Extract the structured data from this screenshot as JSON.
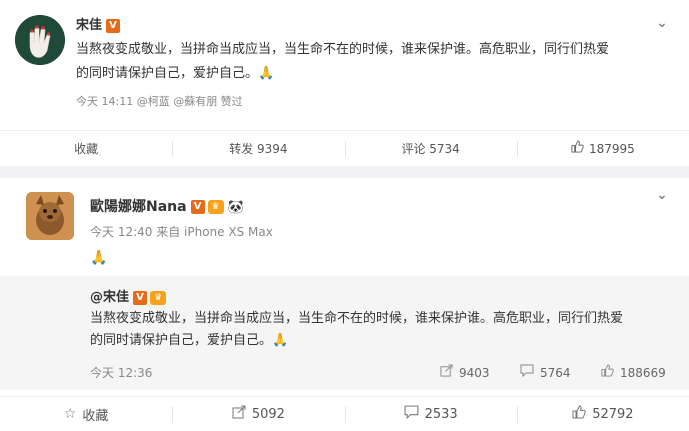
{
  "post1": {
    "author": "宋佳",
    "verified_badge": "V",
    "text_line1": "当熬夜变成敬业，当拼命当成应当，当生命不在的时候，谁来保护谁。高危职业，同行们热爱",
    "text_line2": "的同时请保护自己，爱护自己。🙏",
    "meta": "今天 14:11 @柯蓝 @蘇有朋 赞过",
    "actions": {
      "favorite": "收藏",
      "repost": "转发 9394",
      "comment": "评论 5734",
      "like": "187995"
    }
  },
  "post2": {
    "author": "歐陽娜娜Nana",
    "verified_badge": "V",
    "crown_badge": "♛",
    "panda": "🐼",
    "meta": "今天 12:40 来自 iPhone XS Max",
    "text": "🙏",
    "repost": {
      "author": "@宋佳",
      "verified_badge": "V",
      "crown_badge": "♛",
      "text_line1": "当熬夜变成敬业，当拼命当成应当，当生命不在的时候，谁来保护谁。高危职业，同行们热爱",
      "text_line2": "的同时请保护自己，爱护自己。🙏",
      "time": "今天 12:36",
      "reposts": "9403",
      "comments": "5764",
      "likes": "188669"
    },
    "actions": {
      "favorite": "收藏",
      "repost": "5092",
      "comment": "2533",
      "like": "52792"
    }
  },
  "icons": {
    "chevron": "⌄",
    "star": "☆",
    "share": "↗",
    "comment": "💬",
    "like": "👍"
  }
}
